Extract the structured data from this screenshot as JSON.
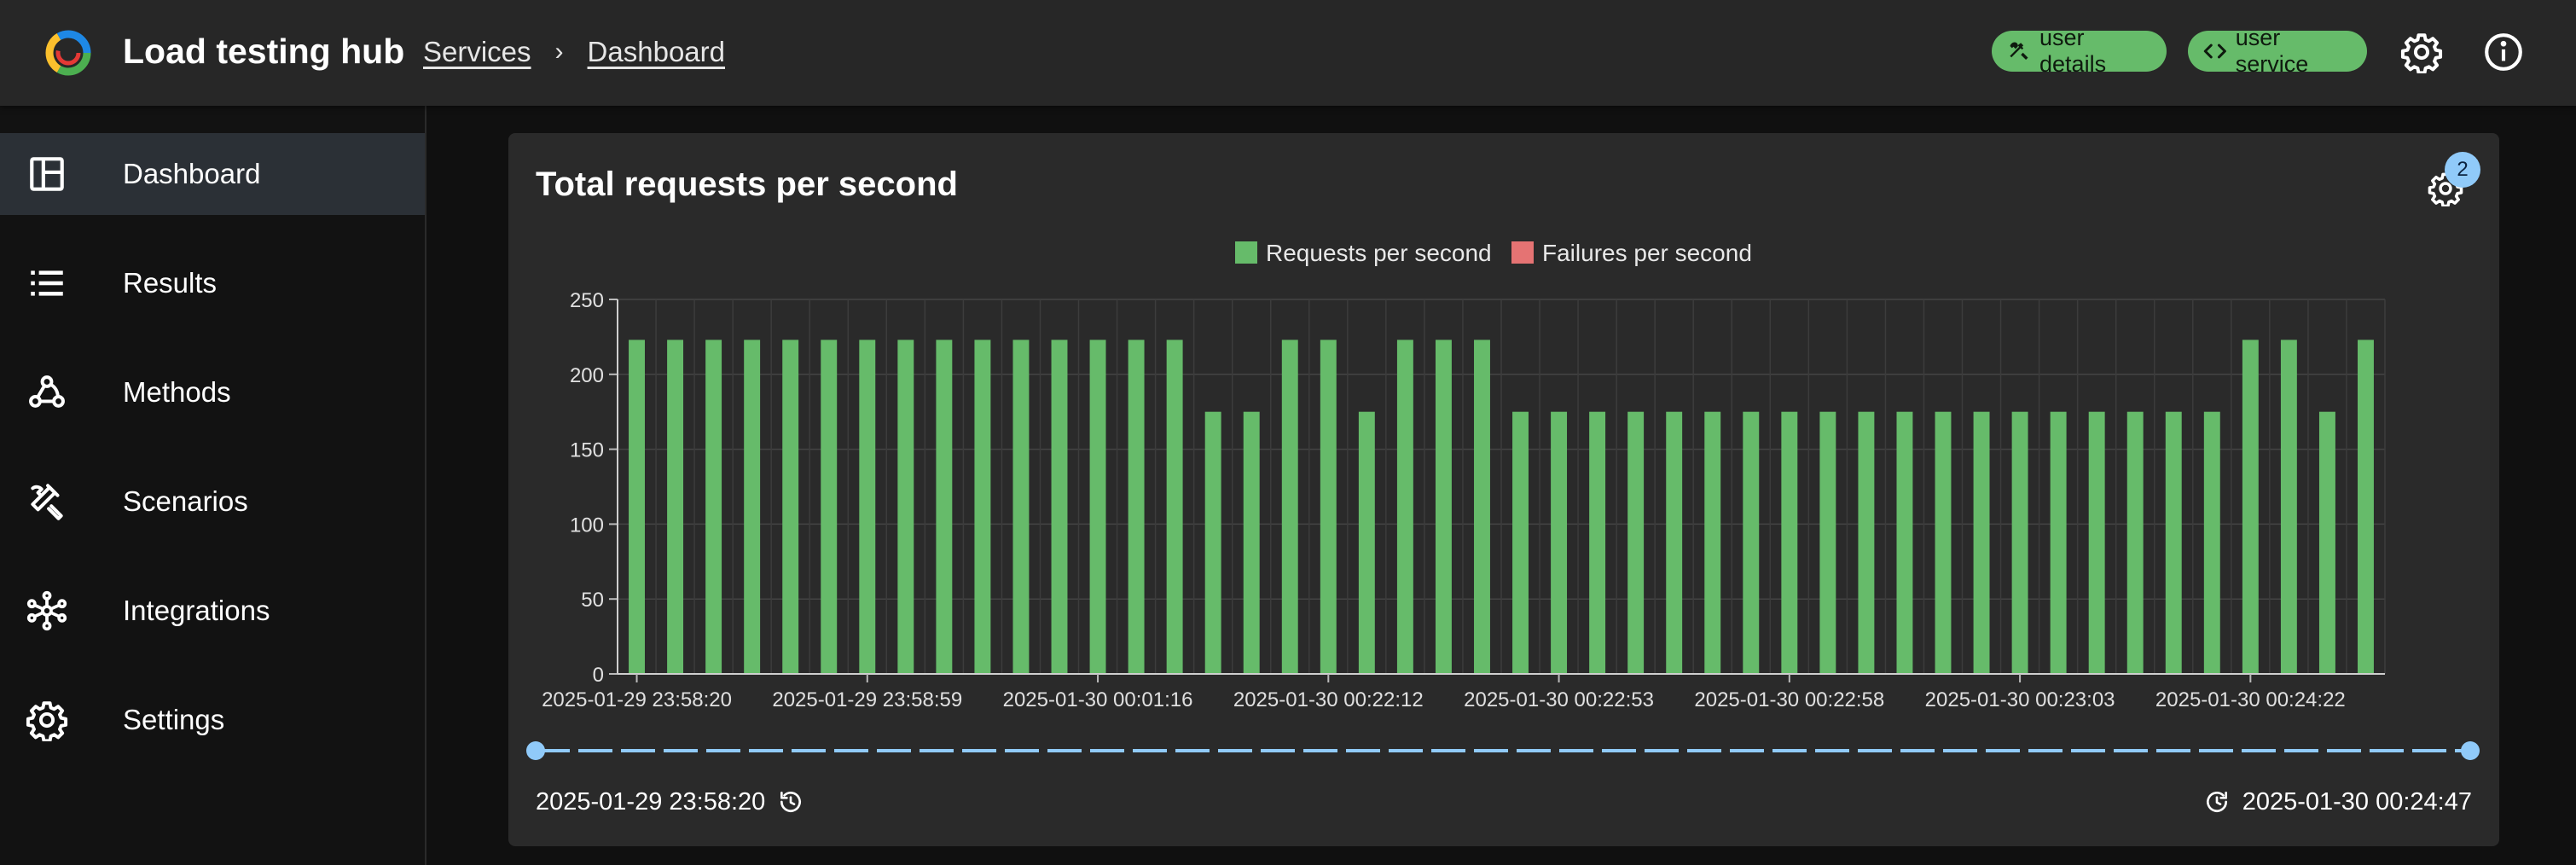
{
  "app": {
    "title": "Load testing hub"
  },
  "breadcrumbs": [
    {
      "label": "Services"
    },
    {
      "label": "Dashboard"
    }
  ],
  "header": {
    "chips": [
      {
        "label": "user details",
        "icon": "hammer-wrench-icon"
      },
      {
        "label": "user service",
        "icon": "code-brackets-icon"
      }
    ],
    "icons": [
      "gear-icon",
      "info-icon"
    ]
  },
  "sidebar": {
    "items": [
      {
        "label": "Dashboard",
        "icon": "dashboard-icon",
        "active": true
      },
      {
        "label": "Results",
        "icon": "list-icon",
        "active": false
      },
      {
        "label": "Methods",
        "icon": "webhook-icon",
        "active": false
      },
      {
        "label": "Scenarios",
        "icon": "tools-icon",
        "active": false
      },
      {
        "label": "Integrations",
        "icon": "hub-icon",
        "active": false
      },
      {
        "label": "Settings",
        "icon": "gear-icon",
        "active": false
      }
    ]
  },
  "card": {
    "title": "Total requests per second",
    "settings_badge": "2",
    "range_start": "2025-01-29 23:58:20",
    "range_end": "2025-01-30 00:24:47"
  },
  "colors": {
    "accent_green": "#66bb6a",
    "failure_red": "#e57373",
    "slider_blue": "#90caf9"
  },
  "chart_data": {
    "type": "bar",
    "title": "Total requests per second",
    "ylim": [
      0,
      250
    ],
    "yticks": [
      0,
      50,
      100,
      150,
      200,
      250
    ],
    "grid": true,
    "legend": "top",
    "xtick_labels": [
      "2025-01-29 23:58:20",
      "2025-01-29 23:58:59",
      "2025-01-30 00:01:16",
      "2025-01-30 00:22:12",
      "2025-01-30 00:22:53",
      "2025-01-30 00:22:58",
      "2025-01-30 00:23:03",
      "2025-01-30 00:24:22"
    ],
    "series": [
      {
        "name": "Requests per second",
        "color": "#66bb6a",
        "values": [
          223,
          223,
          223,
          223,
          223,
          223,
          223,
          223,
          223,
          223,
          223,
          223,
          223,
          223,
          223,
          175,
          175,
          223,
          223,
          175,
          223,
          223,
          223,
          175,
          175,
          175,
          175,
          175,
          175,
          175,
          175,
          175,
          175,
          175,
          175,
          175,
          175,
          175,
          175,
          175,
          175,
          175,
          223,
          223,
          175,
          223
        ]
      },
      {
        "name": "Failures per second",
        "color": "#e57373",
        "values": [
          0,
          0,
          0,
          0,
          0,
          0,
          0,
          0,
          0,
          0,
          0,
          0,
          0,
          0,
          0,
          0,
          0,
          0,
          0,
          0,
          0,
          0,
          0,
          0,
          0,
          0,
          0,
          0,
          0,
          0,
          0,
          0,
          0,
          0,
          0,
          0,
          0,
          0,
          0,
          0,
          0,
          0,
          0,
          0,
          0,
          0
        ]
      }
    ]
  }
}
